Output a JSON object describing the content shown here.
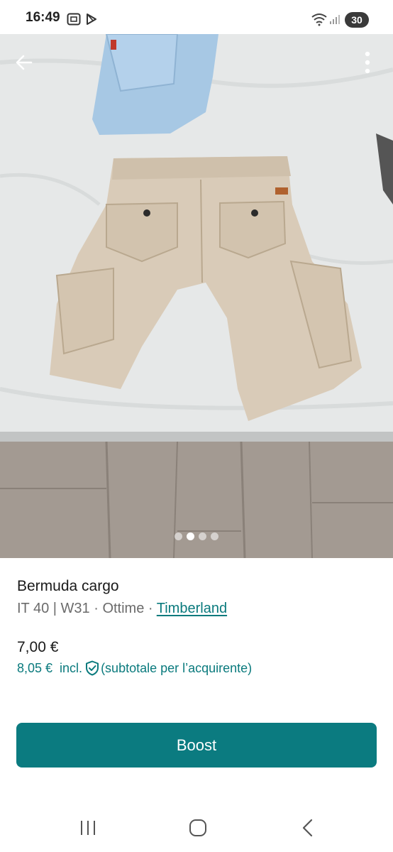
{
  "status_bar": {
    "time": "16:49",
    "battery": "30",
    "icons": [
      "screenshot-icon",
      "play-store-icon",
      "wifi-icon",
      "signal-icon"
    ]
  },
  "gallery": {
    "image_count": 4,
    "active_index": 1
  },
  "item": {
    "title": "Bermuda cargo",
    "size": "IT 40 | W31",
    "separator1": " · ",
    "condition": "Ottime",
    "separator2": " · ",
    "brand": "Timberland",
    "price": "7,00 €",
    "price_incl_amount": "8,05 €",
    "price_incl_label": "incl.",
    "price_incl_note": "(subtotale per l’acquirente)"
  },
  "actions": {
    "boost_label": "Boost"
  },
  "colors": {
    "accent": "#0b7b80",
    "link": "#0a7a7d"
  }
}
